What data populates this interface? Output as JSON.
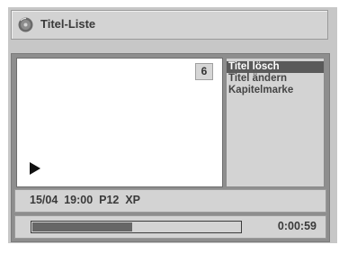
{
  "window": {
    "title": "Titel-Liste",
    "icon": "disc-icon"
  },
  "preview": {
    "title_count": "6",
    "play_icon": "play-icon"
  },
  "menu": {
    "items": [
      {
        "label": "Titel lösch",
        "selected": true
      },
      {
        "label": "Titel ändern",
        "selected": false
      },
      {
        "label": "Kapitelmarke",
        "selected": false
      }
    ]
  },
  "info": {
    "line": "15/04  19:00  P12  XP"
  },
  "playback": {
    "progress_fraction": 0.48,
    "time": "0:00:59"
  }
}
